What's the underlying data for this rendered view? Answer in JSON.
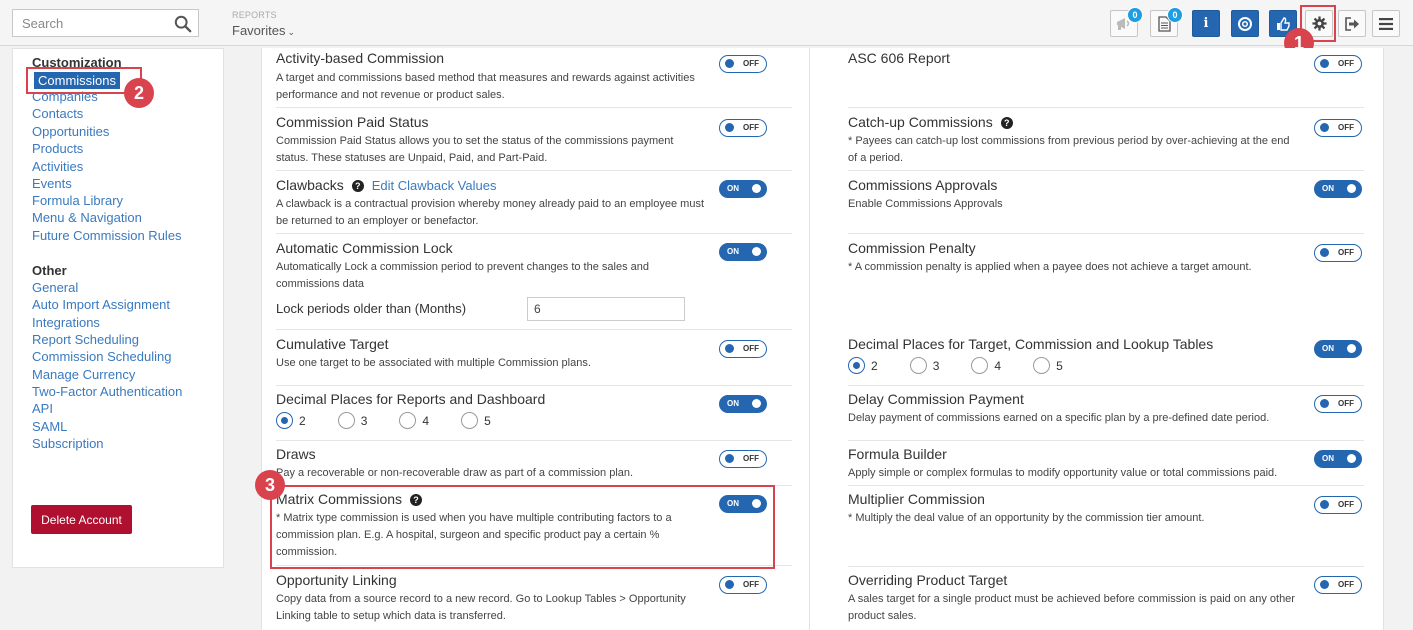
{
  "topbar": {
    "search_placeholder": "Search",
    "reports_label": "REPORTS",
    "favorites_label": "Favorites",
    "announcements_badge": "0",
    "documents_badge": "0",
    "icons": [
      "megaphone-icon",
      "document-icon",
      "info-icon",
      "help-icon",
      "thumbs-up-icon",
      "gear-icon",
      "logout-icon",
      "hamburger-menu-icon"
    ]
  },
  "steps": {
    "one": "1",
    "two": "2",
    "three": "3"
  },
  "sidebar": {
    "customization_heading": "Customization",
    "customization_items": [
      "Commissions",
      "Companies",
      "Contacts",
      "Opportunities",
      "Products",
      "Activities",
      "Events",
      "Formula Library",
      "Menu & Navigation",
      "Future Commission Rules"
    ],
    "other_heading": "Other",
    "other_items": [
      "General",
      "Auto Import Assignment",
      "Integrations",
      "Report Scheduling",
      "Commission Scheduling",
      "Manage Currency",
      "Two-Factor Authentication",
      "API",
      "SAML",
      "Subscription"
    ],
    "delete_account": "Delete Account"
  },
  "left_settings": {
    "activity": {
      "title": "Activity-based Commission",
      "desc": "A target and commissions based method that measures and rewards against activities performance and not revenue or product sales.",
      "state": "OFF"
    },
    "paid_status": {
      "title": "Commission Paid Status",
      "desc": "Commission Paid Status allows you to set the status of the commissions payment status. These statuses are Unpaid, Paid, and Part-Paid.",
      "state": "OFF"
    },
    "clawbacks": {
      "title": "Clawbacks",
      "edit_link": "Edit Clawback Values",
      "desc": "A clawback is a contractual provision whereby money already paid to an employee must be returned to an employer or benefactor.",
      "state": "ON"
    },
    "auto_lock": {
      "title": "Automatic Commission Lock",
      "desc": "Automatically Lock a commission period to prevent changes to the sales and commissions data",
      "state": "ON",
      "lock_label": "Lock periods older than (Months)",
      "lock_value": "6"
    },
    "cumulative": {
      "title": "Cumulative Target",
      "desc": "Use one target to be associated with multiple Commission plans.",
      "state": "OFF"
    },
    "decimal_reports": {
      "title": "Decimal Places for Reports and Dashboard",
      "options": [
        "2",
        "3",
        "4",
        "5"
      ],
      "selected": "2",
      "state": "ON"
    },
    "draws": {
      "title": "Draws",
      "desc": "Pay a recoverable or non-recoverable draw as part of a commission plan.",
      "state": "OFF"
    },
    "matrix": {
      "title": "Matrix Commissions",
      "desc": "* Matrix type commission is used when you have multiple contributing factors to a commission plan. E.g. A hospital, surgeon and specific product pay a certain % commission.",
      "state": "ON"
    },
    "opp_linking": {
      "title": "Opportunity Linking",
      "desc": "Copy data from a source record to a new record. Go to Lookup Tables > Opportunity Linking table to setup which data is transferred.",
      "state": "OFF"
    }
  },
  "right_settings": {
    "asc606": {
      "title": "ASC 606 Report",
      "state": "OFF"
    },
    "catchup": {
      "title": "Catch-up Commissions",
      "desc": "* Payees can catch-up lost commissions from previous period by over-achieving at the end of a period.",
      "state": "OFF"
    },
    "approvals": {
      "title": "Commissions Approvals",
      "desc": "Enable Commissions Approvals",
      "state": "ON"
    },
    "penalty": {
      "title": "Commission Penalty",
      "desc": "* A commission penalty is applied when a payee does not achieve a target amount.",
      "state": "OFF"
    },
    "decimal_target": {
      "title": "Decimal Places for Target, Commission and Lookup Tables",
      "options": [
        "2",
        "3",
        "4",
        "5"
      ],
      "selected": "2",
      "state": "ON"
    },
    "delay": {
      "title": "Delay Commission Payment",
      "desc": "Delay payment of commissions earned on a specific plan by a pre-defined date period.",
      "state": "OFF"
    },
    "formula": {
      "title": "Formula Builder",
      "desc": "Apply simple or complex formulas to modify opportunity value or total commissions paid.",
      "state": "ON"
    },
    "multiplier": {
      "title": "Multiplier Commission",
      "desc": "* Multiply the deal value of an opportunity by the commission tier amount.",
      "state": "OFF"
    },
    "overriding": {
      "title": "Overriding Product Target",
      "desc": "A sales target for a single product must be achieved before commission is paid on any other product sales.",
      "state": "OFF"
    }
  },
  "colors": {
    "accent": "#2466b0",
    "highlight": "#d9434e",
    "danger": "#b0102f",
    "link": "#3a7abf"
  }
}
